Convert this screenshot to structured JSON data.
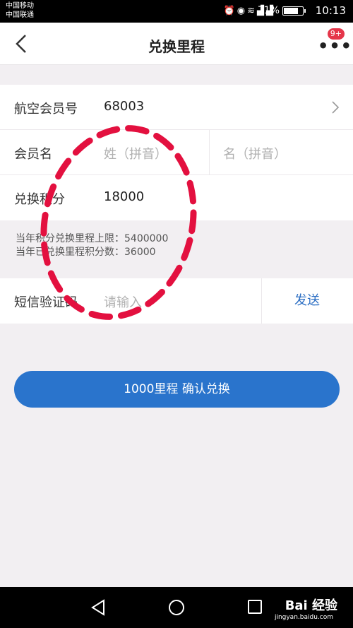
{
  "status_bar": {
    "carrier_1": "中国移动",
    "carrier_2": "中国联通",
    "icons": [
      "alarm-icon",
      "eye-icon",
      "wifi-icon",
      "signal-icon",
      "signal-icon"
    ],
    "battery_text": "71%",
    "battery_level": 0.71,
    "time": "10:13"
  },
  "header": {
    "title": "兑换里程",
    "badge": "9+"
  },
  "form": {
    "member_no_label": "航空会员号",
    "member_no_value": "68003",
    "member_name_label": "会员名",
    "surname_placeholder": "姓（拼音）",
    "given_name_placeholder": "名（拼音）",
    "points_label": "兑换积分",
    "points_value": "18000"
  },
  "info": {
    "line_1": "当年积分兑换里程上限：5400000",
    "line_2": "当年已兑换里程积分数：36000"
  },
  "sms": {
    "label": "短信验证码",
    "placeholder": "请输入",
    "send_label": "发送"
  },
  "confirm_button": "1000里程 确认兑换",
  "watermark": {
    "text": "Bai 经验",
    "url": "jingyan.baidu.com"
  },
  "colors": {
    "accent": "#2a74cc",
    "badge": "#e5364a",
    "annotation": "#e3103f"
  }
}
